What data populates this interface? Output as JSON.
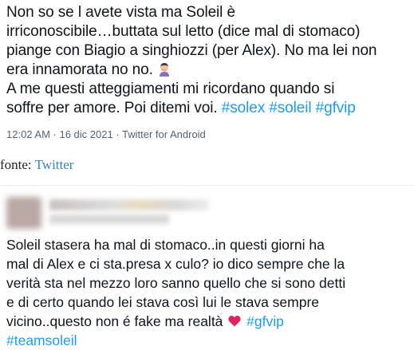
{
  "tweet1": {
    "line1": "Non so se l avete vista ma Soleil è",
    "line2": "irriconoscibile…buttata sul letto (dice mal di stomaco)",
    "line3": "piange con Biagio a singhiozzi (per Alex). No ma lei non",
    "line4": "era innamorata no no.",
    "line5": "A me questi atteggiamenti mi ricordano quando si",
    "line6": "soffre per amore. Poi ditemi voi.",
    "hashtag1": "#solex",
    "hashtag2": "#soleil",
    "hashtag3": "#gfvip",
    "meta": "12:02 AM · 16 dic 2021 · Twitter for Android",
    "emoji_icon": "woman-facepalming-icon"
  },
  "caption": {
    "prefix": "fonte: ",
    "link": "Twitter"
  },
  "tweet2": {
    "line1": "Soleil stasera ha mal di stomaco..in questi giorni ha",
    "line2": "mal di Alex e ci sta.presa x culo? io dico sempre che la",
    "line3": "verità sta nel mezzo loro sanno quello che si sono detti",
    "line4": "e di certo quando lei stava così lui le stava sempre",
    "line5a": "vicino..questo non é fake ma realtà",
    "hashtag1": "#gfvip",
    "hashtag2": "#teamsoleil",
    "heart_icon": "red-heart-icon",
    "heart_color": "#e0245e"
  }
}
